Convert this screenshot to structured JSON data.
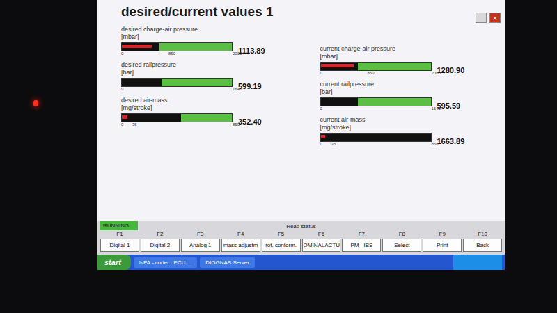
{
  "window": {
    "title": "desired/current values 1",
    "controls": [
      "×"
    ]
  },
  "desired": [
    {
      "label": "desired charge-air pressure",
      "unit": "[mbar]",
      "scale": [
        "0",
        "850",
        "2000"
      ],
      "value": "1113.89",
      "level": 0.34,
      "red_level": 0.27
    },
    {
      "label": "desired railpressure",
      "unit": "[bar]",
      "scale": [
        "0",
        "1640"
      ],
      "value": "599.19",
      "level": 0.36,
      "red_level": 0
    },
    {
      "label": "desired air-mass",
      "unit": "[mg/stroke]",
      "scale": [
        "0",
        "35",
        "850"
      ],
      "value": "352.40",
      "level": 0.54,
      "red_level": 0.05
    }
  ],
  "current": [
    {
      "label": "current charge-air pressure",
      "unit": "[mbar]",
      "scale": [
        "0",
        "850",
        "2000"
      ],
      "value": "1280.90",
      "level": 0.34,
      "red_level": 0.3
    },
    {
      "label": "current railpressure",
      "unit": "[bar]",
      "scale": [
        "0",
        "1640"
      ],
      "value": "595.59",
      "level": 0.34,
      "red_level": 0
    },
    {
      "label": "current air-mass",
      "unit": "[mg/stroke]",
      "scale": [
        "0",
        "35",
        "850"
      ],
      "value": "1663.89",
      "level": 1.0,
      "red_level": 0.04
    }
  ],
  "status": {
    "label": "RUNNING"
  },
  "read_status": "Read status",
  "fkeys": [
    {
      "key": "F1",
      "label": "Digital 1"
    },
    {
      "key": "F2",
      "label": "Digital 2"
    },
    {
      "key": "F3",
      "label": "Analog 1"
    },
    {
      "key": "F4",
      "label": "mass adjustm"
    },
    {
      "key": "F5",
      "label": "rot. conform."
    },
    {
      "key": "F6",
      "label": "OMINALACTU"
    },
    {
      "key": "F7",
      "label": "PM - IBS"
    },
    {
      "key": "F8",
      "label": "Select"
    },
    {
      "key": "F9",
      "label": "Print"
    },
    {
      "key": "F10",
      "label": "Back"
    }
  ],
  "taskbar": {
    "start": "start",
    "tasks": [
      "IsPA - coder : ECU ...",
      "DIOGNAS Server"
    ]
  }
}
